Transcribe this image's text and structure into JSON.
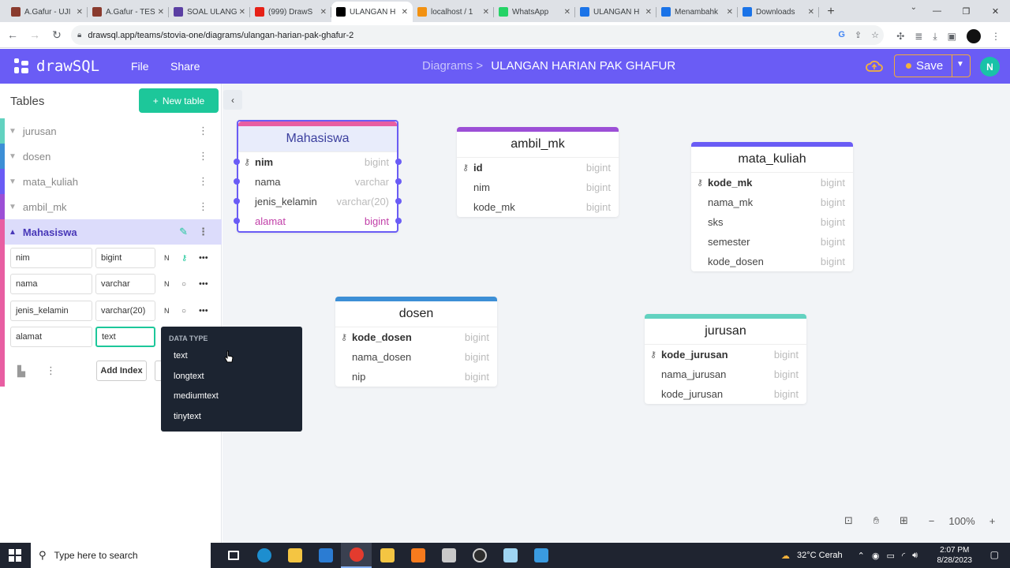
{
  "browser": {
    "tabs": [
      {
        "title": "A.Gafur - UJI",
        "color": "#8a3b2e"
      },
      {
        "title": "A.Gafur - TES",
        "color": "#8a3b2e"
      },
      {
        "title": "SOAL ULANG",
        "color": "#5b3fa3"
      },
      {
        "title": "(999) DrawS",
        "color": "#e62117"
      },
      {
        "title": "ULANGAN H",
        "color": "#000000",
        "active": true
      },
      {
        "title": "localhost / 1",
        "color": "#f29111"
      },
      {
        "title": "WhatsApp",
        "color": "#25d366"
      },
      {
        "title": "ULANGAN H",
        "color": "#1a73e8"
      },
      {
        "title": "Menambahk",
        "color": "#1a73e8"
      },
      {
        "title": "Downloads",
        "color": "#1a73e8"
      }
    ],
    "url": "drawsql.app/teams/stovia-one/diagrams/ulangan-harian-pak-ghafur-2"
  },
  "app": {
    "logo": "drawSQL",
    "menu": {
      "file": "File",
      "share": "Share"
    },
    "breadcrumb_prefix": "Diagrams >",
    "diagram_title": "ULANGAN HARIAN PAK GHAFUR",
    "save_label": "Save",
    "avatar_initial": "N",
    "brand_color": "#6a5cf5"
  },
  "sidebar": {
    "title": "Tables",
    "new_table_label": "New table",
    "tables": [
      {
        "name": "jurusan",
        "color": "#62d2c0"
      },
      {
        "name": "dosen",
        "color": "#3d8fd6"
      },
      {
        "name": "mata_kuliah",
        "color": "#6a5cf5"
      },
      {
        "name": "ambil_mk",
        "color": "#9c4fd6"
      },
      {
        "name": "Mahasiswa",
        "color": "#e85ea2",
        "active": true
      }
    ],
    "columns": [
      {
        "name": "nim",
        "type": "bigint",
        "nullable": "N",
        "key": true
      },
      {
        "name": "nama",
        "type": "varchar",
        "nullable": "N"
      },
      {
        "name": "jenis_kelamin",
        "type": "varchar(20)",
        "nullable": "N"
      },
      {
        "name": "alamat",
        "type": "text"
      }
    ],
    "add_index_label": "Add Index"
  },
  "datatype_dropdown": {
    "header": "DATA TYPE",
    "options": [
      "text",
      "longtext",
      "mediumtext",
      "tinytext"
    ]
  },
  "diagram": {
    "tables": [
      {
        "name": "Mahasiswa",
        "color": "#e85ea2",
        "selected": true,
        "columns": [
          {
            "name": "nim",
            "type": "bigint",
            "pk": true
          },
          {
            "name": "nama",
            "type": "varchar"
          },
          {
            "name": "jenis_kelamin",
            "type": "varchar(20)"
          },
          {
            "name": "alamat",
            "type": "bigint",
            "highlight": true
          }
        ]
      },
      {
        "name": "ambil_mk",
        "color": "#9c4fd6",
        "columns": [
          {
            "name": "id",
            "type": "bigint",
            "pk": true
          },
          {
            "name": "nim",
            "type": "bigint"
          },
          {
            "name": "kode_mk",
            "type": "bigint"
          }
        ]
      },
      {
        "name": "mata_kuliah",
        "color": "#6a5cf5",
        "columns": [
          {
            "name": "kode_mk",
            "type": "bigint",
            "pk": true
          },
          {
            "name": "nama_mk",
            "type": "bigint"
          },
          {
            "name": "sks",
            "type": "bigint"
          },
          {
            "name": "semester",
            "type": "bigint"
          },
          {
            "name": "kode_dosen",
            "type": "bigint"
          }
        ]
      },
      {
        "name": "dosen",
        "color": "#3d8fd6",
        "columns": [
          {
            "name": "kode_dosen",
            "type": "bigint",
            "pk": true
          },
          {
            "name": "nama_dosen",
            "type": "bigint"
          },
          {
            "name": "nip",
            "type": "bigint"
          }
        ]
      },
      {
        "name": "jurusan",
        "color": "#62d2c0",
        "columns": [
          {
            "name": "kode_jurusan",
            "type": "bigint",
            "pk": true
          },
          {
            "name": "nama_jurusan",
            "type": "bigint"
          },
          {
            "name": "kode_jurusan",
            "type": "bigint"
          }
        ]
      }
    ]
  },
  "zoom": {
    "level": "100%"
  },
  "taskbar": {
    "search_placeholder": "Type here to search",
    "weather": "32°C  Cerah",
    "time": "2:07 PM",
    "date": "8/28/2023"
  }
}
